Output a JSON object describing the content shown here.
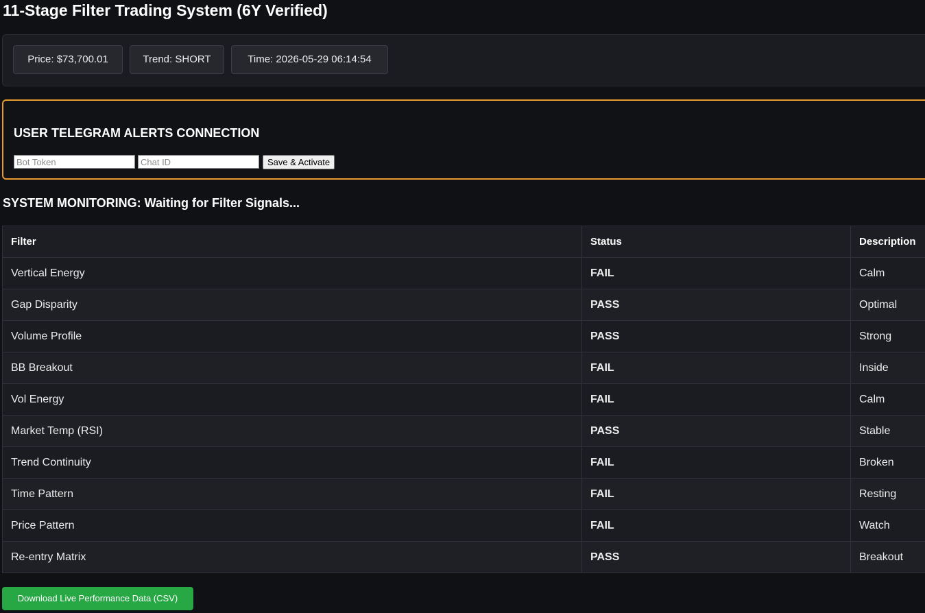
{
  "page": {
    "title": "11-Stage Filter Trading System (6Y Verified)"
  },
  "stats": {
    "price": "Price: $73,700.01",
    "trend": "Trend: SHORT",
    "time": "Time: 2026-05-29 06:14:54"
  },
  "telegram": {
    "title": "USER TELEGRAM ALERTS CONNECTION",
    "bot_token_placeholder": "Bot Token",
    "bot_token_value": "",
    "chat_id_placeholder": "Chat ID",
    "chat_id_value": "",
    "save_label": "Save & Activate"
  },
  "monitor": {
    "title": "SYSTEM MONITORING: Waiting for Filter Signals..."
  },
  "table": {
    "headers": [
      "Filter",
      "Status",
      "Description"
    ],
    "rows": [
      {
        "filter": "Vertical Energy",
        "status": "FAIL",
        "description": "Calm"
      },
      {
        "filter": "Gap Disparity",
        "status": "PASS",
        "description": "Optimal"
      },
      {
        "filter": "Volume Profile",
        "status": "PASS",
        "description": "Strong"
      },
      {
        "filter": "BB Breakout",
        "status": "FAIL",
        "description": "Inside"
      },
      {
        "filter": "Vol Energy",
        "status": "FAIL",
        "description": "Calm"
      },
      {
        "filter": "Market Temp (RSI)",
        "status": "PASS",
        "description": "Stable"
      },
      {
        "filter": "Trend Continuity",
        "status": "FAIL",
        "description": "Broken"
      },
      {
        "filter": "Time Pattern",
        "status": "FAIL",
        "description": "Resting"
      },
      {
        "filter": "Price Pattern",
        "status": "FAIL",
        "description": "Watch"
      },
      {
        "filter": "Re-entry Matrix",
        "status": "PASS",
        "description": "Breakout"
      }
    ]
  },
  "download": {
    "label": "Download Live Performance Data (CSV)"
  },
  "colors": {
    "pass": "#4caf50",
    "fail": "#f44336",
    "accent_border": "#e89b2f",
    "download_button": "#28a745"
  }
}
